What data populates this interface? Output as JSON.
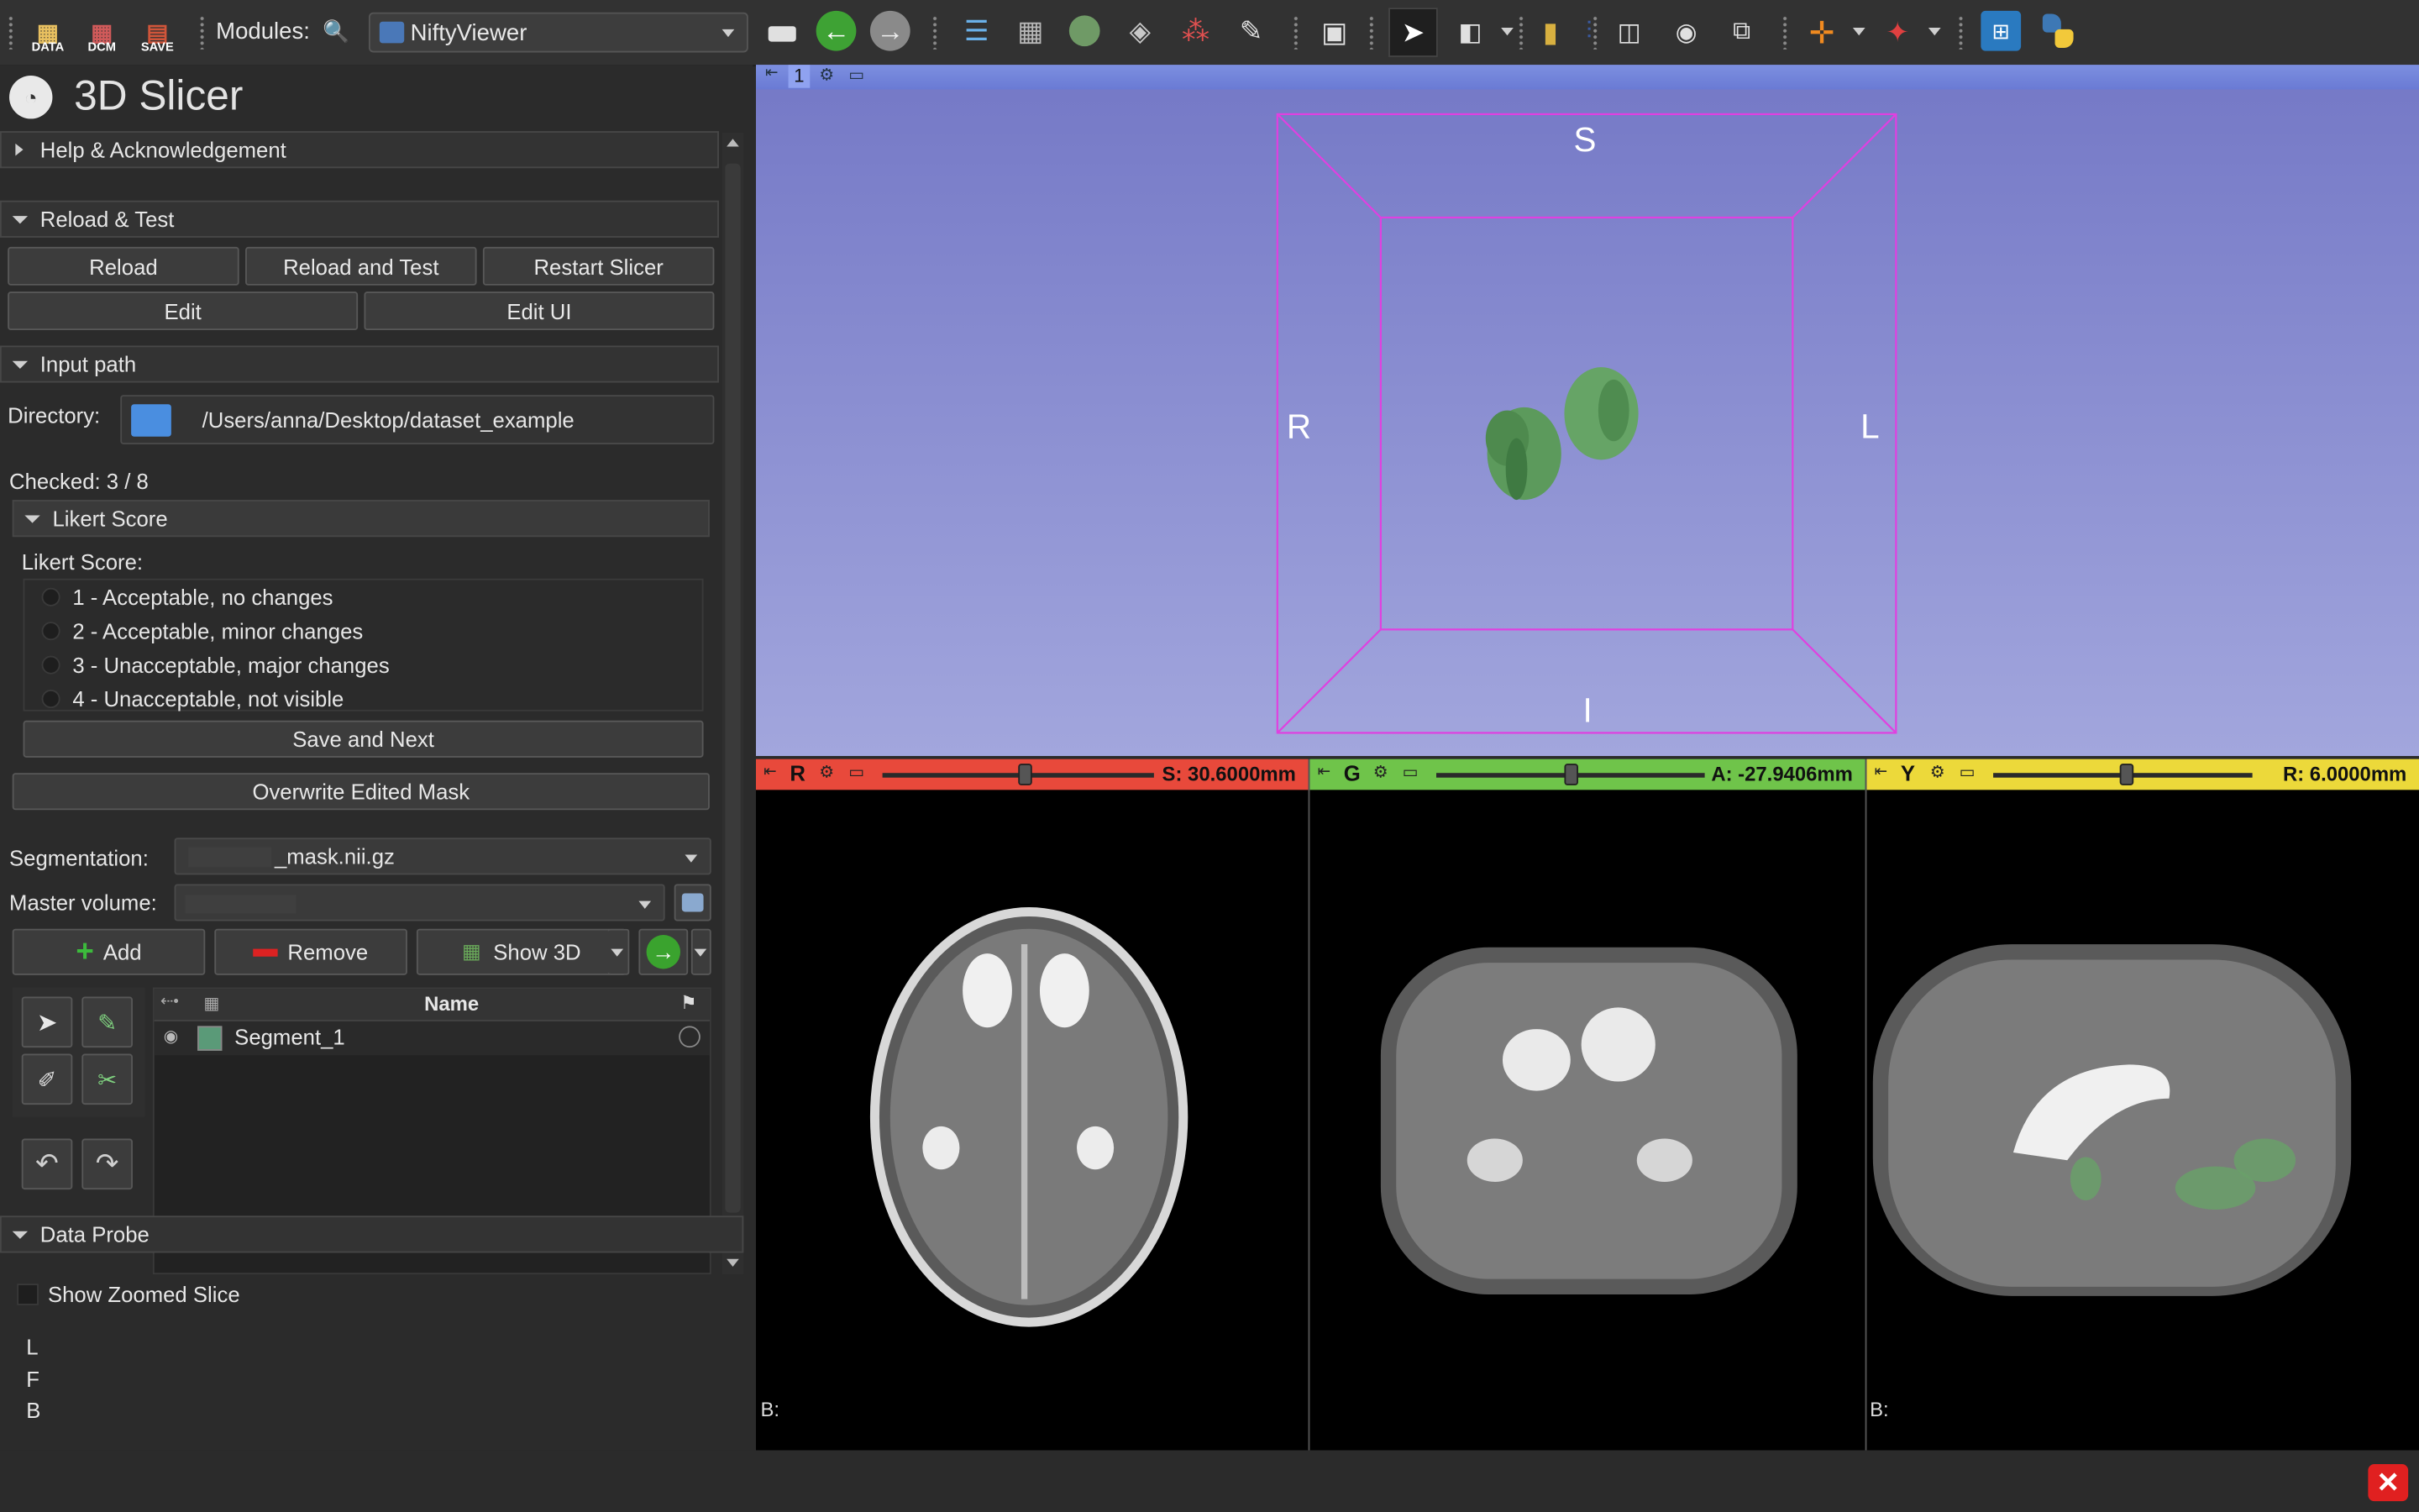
{
  "toolbar": {
    "modules_label": "Modules:",
    "module_selected": "NiftyViewer",
    "data_label": "DATA",
    "dcm_label": "DCM",
    "save_label": "SAVE"
  },
  "app": {
    "title": "3D Slicer"
  },
  "sections": {
    "help": "Help & Acknowledgement",
    "reload_test": "Reload & Test",
    "input_path": "Input path",
    "likert": "Likert Score",
    "data_probe": "Data Probe"
  },
  "reload_buttons": {
    "reload": "Reload",
    "reload_and_test": "Reload and Test",
    "restart": "Restart Slicer",
    "edit": "Edit",
    "edit_ui": "Edit UI"
  },
  "input": {
    "directory_label": "Directory:",
    "directory_value": "/Users/anna/Desktop/dataset_example",
    "checked": "Checked: 3 / 8"
  },
  "likert": {
    "label": "Likert Score:",
    "options": [
      "1 - Acceptable, no changes",
      "2 - Acceptable, minor changes",
      "3 - Unacceptable, major changes",
      "4 - Unacceptable, not visible"
    ],
    "save_next": "Save and Next",
    "overwrite": "Overwrite Edited Mask"
  },
  "segmentation": {
    "label": "Segmentation:",
    "value": "_mask.nii.gz",
    "master_label": "Master volume:",
    "add": "Add",
    "remove": "Remove",
    "show3d": "Show 3D",
    "table_header_name": "Name",
    "segment_name": "Segment_1",
    "segment_color": "#5a9a78"
  },
  "probe": {
    "show_zoomed": "Show Zoomed Slice",
    "lines": [
      "L",
      "F",
      "B"
    ]
  },
  "view3d": {
    "layout_number": "1",
    "labels": {
      "s": "S",
      "r": "R",
      "l": "L",
      "i": "I"
    }
  },
  "slices": [
    {
      "letter": "R",
      "value": "S: 30.6000mm",
      "color": "#e8493b",
      "level": 0.52,
      "footer": "B:"
    },
    {
      "letter": "G",
      "value": "A: -27.9406mm",
      "color": "#6fc44a",
      "level": 0.5,
      "footer": ""
    },
    {
      "letter": "Y",
      "value": "R: 6.0000mm",
      "color": "#ecd93a",
      "level": 0.51,
      "footer": "B:"
    }
  ],
  "colors": {
    "accent_green": "#3a9a2a",
    "close_red": "#e02020"
  }
}
